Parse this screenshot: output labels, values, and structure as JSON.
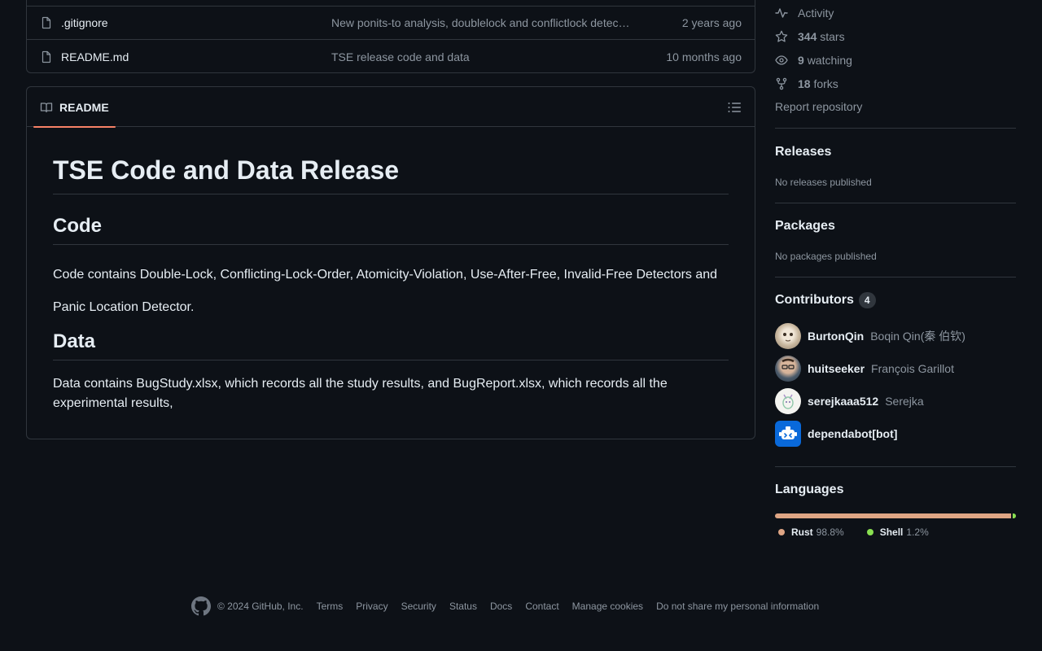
{
  "files": [
    {
      "name": ".gitignore",
      "message": "New ponits-to analysis, doublelock and conflictlock detec…",
      "date": "2 years ago"
    },
    {
      "name": "README.md",
      "message": "TSE release code and data",
      "date": "10 months ago"
    }
  ],
  "readme": {
    "tab_label": "README",
    "title": "TSE Code and Data Release",
    "code_heading": "Code",
    "code_text": "Code contains Double-Lock, Conflicting-Lock-Order, Atomicity-Violation, Use-After-Free, Invalid-Free Detectors and Panic Location Detector.",
    "data_heading": "Data",
    "data_text": "Data contains BugStudy.xlsx, which records all the study results, and BugReport.xlsx, which records all the experimental results,"
  },
  "about": {
    "activity": "Activity",
    "stars_count": "344",
    "stars_label": "stars",
    "watching_count": "9",
    "watching_label": "watching",
    "forks_count": "18",
    "forks_label": "forks",
    "report": "Report repository"
  },
  "releases": {
    "heading": "Releases",
    "empty": "No releases published"
  },
  "packages": {
    "heading": "Packages",
    "empty": "No packages published"
  },
  "contributors": {
    "heading": "Contributors",
    "count": "4",
    "items": [
      {
        "login": "BurtonQin",
        "name": "Boqin Qin(秦 伯钦)"
      },
      {
        "login": "huitseeker",
        "name": "François Garillot"
      },
      {
        "login": "serejkaaa512",
        "name": "Serejka"
      },
      {
        "login": "dependabot[bot]",
        "name": ""
      }
    ]
  },
  "languages": {
    "heading": "Languages",
    "items": [
      {
        "name": "Rust",
        "percent": "98.8%",
        "value": 98.8,
        "color": "#dea584"
      },
      {
        "name": "Shell",
        "percent": "1.2%",
        "value": 1.2,
        "color": "#89e051"
      }
    ]
  },
  "footer": {
    "copyright": "© 2024 GitHub, Inc.",
    "links": [
      "Terms",
      "Privacy",
      "Security",
      "Status",
      "Docs",
      "Contact",
      "Manage cookies",
      "Do not share my personal information"
    ]
  }
}
